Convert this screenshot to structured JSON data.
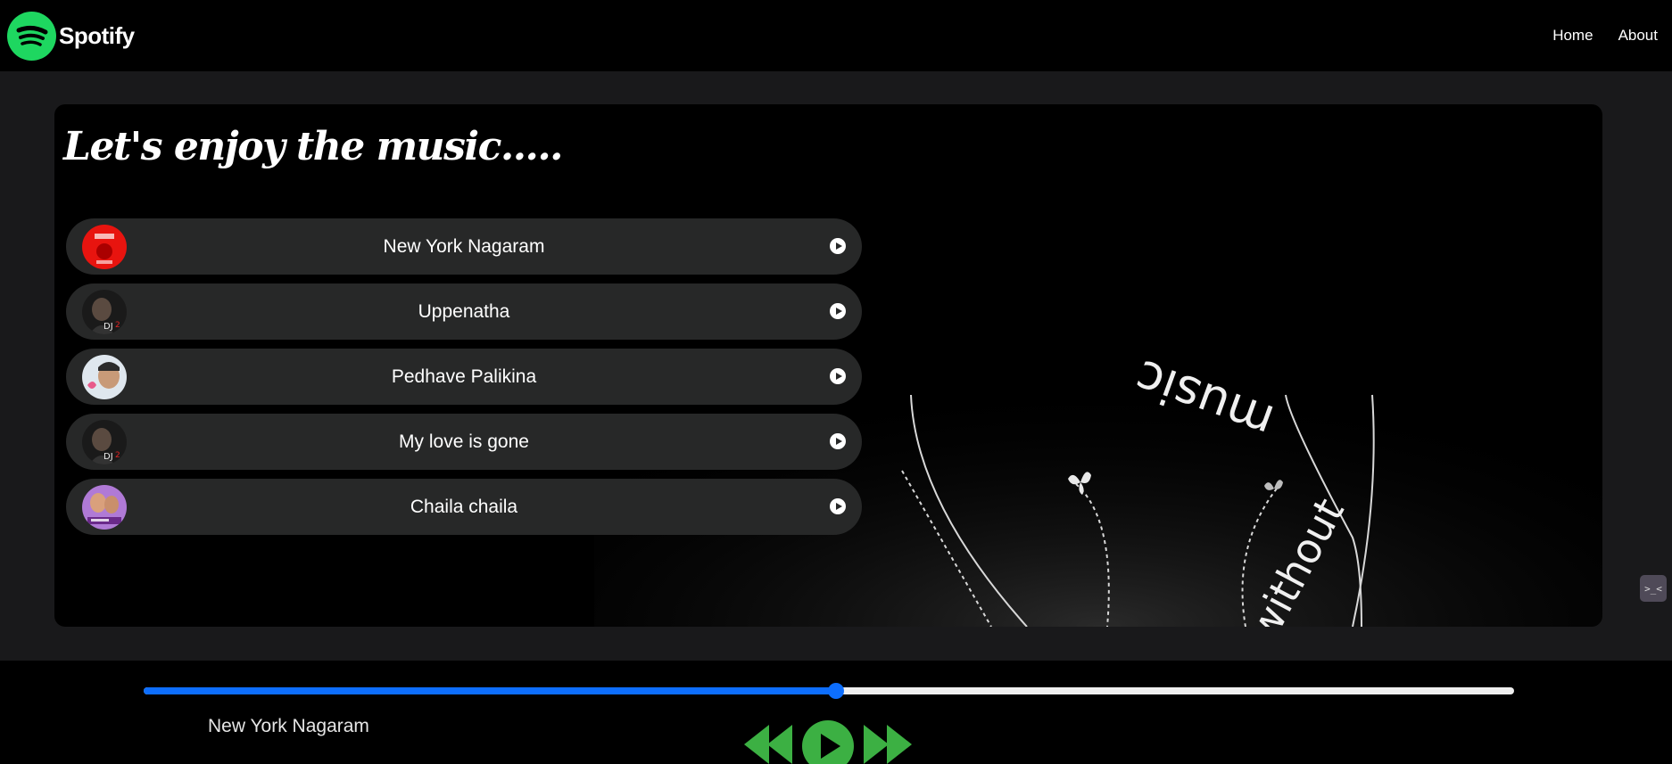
{
  "brand": {
    "name": "Spotify"
  },
  "nav": {
    "home": "Home",
    "about": "About"
  },
  "main": {
    "heading": "Let's enjoy the music.....",
    "art_text": {
      "word1": "music",
      "word2": "without"
    },
    "songs": [
      {
        "title": "New York Nagaram"
      },
      {
        "title": "Uppenatha"
      },
      {
        "title": "Pedhave Palikina"
      },
      {
        "title": "My love is gone"
      },
      {
        "title": "Chaila chaila"
      }
    ]
  },
  "player": {
    "now_playing": "New York Nagaram",
    "progress_percent": 50.5
  },
  "colors": {
    "brand_green": "#1ed760",
    "progress_blue": "#0d6efd",
    "control_green": "#3cb043"
  },
  "side_widget": {
    "label": ">_<"
  }
}
